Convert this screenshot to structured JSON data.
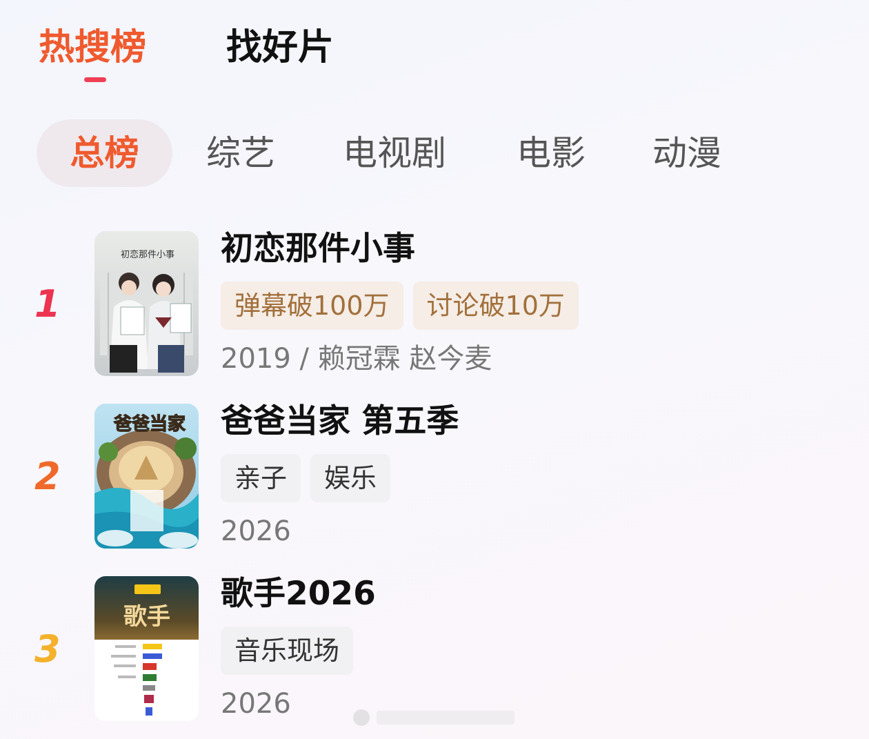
{
  "top_tabs": {
    "hot": "热搜榜",
    "find": "找好片"
  },
  "category_tabs": [
    "总榜",
    "综艺",
    "电视剧",
    "电影",
    "动漫"
  ],
  "ranking": [
    {
      "rank": "1",
      "title": "初恋那件小事",
      "tags": [
        "弹幕破100万",
        "讨论破10万"
      ],
      "meta": "2019 / 赖冠霖 赵今麦",
      "poster_text": "初恋那件小事"
    },
    {
      "rank": "2",
      "title": "爸爸当家 第五季",
      "tags": [
        "亲子",
        "娱乐"
      ],
      "meta": "2026",
      "poster_text": "爸爸当家"
    },
    {
      "rank": "3",
      "title": "歌手2026",
      "tags": [
        "音乐现场"
      ],
      "meta": "2026",
      "poster_text": "歌手"
    }
  ],
  "colors": {
    "accent": "#ef5a2e",
    "rank1": "#ec3350",
    "rank2": "#ef6a2a",
    "rank3": "#f3b12c",
    "tag_gold_bg": "#f5ede6",
    "tag_gold_text": "#a2703c"
  }
}
